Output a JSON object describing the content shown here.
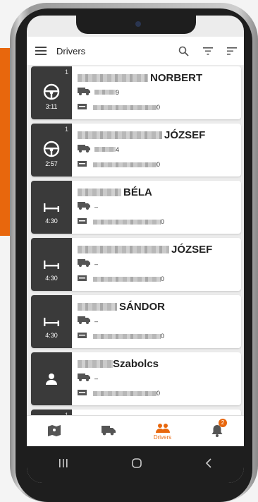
{
  "screen": {
    "title": "Drivers"
  },
  "drivers": [
    {
      "name": "NORBERT",
      "count": "1",
      "time": "3:11",
      "status": "driving",
      "truck": "9",
      "card": "0"
    },
    {
      "name": "JÓZSEF",
      "count": "1",
      "time": "2:57",
      "status": "driving",
      "truck": "4",
      "card": "0"
    },
    {
      "name": "BÉLA",
      "count": "",
      "time": "4:30",
      "status": "rest",
      "truck": "–",
      "card": "0"
    },
    {
      "name": "JÓZSEF",
      "count": "",
      "time": "4:30",
      "status": "rest",
      "truck": "–",
      "card": "0"
    },
    {
      "name": "SÁNDOR",
      "count": "",
      "time": "4:30",
      "status": "rest",
      "truck": "–",
      "card": "0"
    },
    {
      "name": "Szabolcs",
      "count": "",
      "time": "",
      "status": "person",
      "truck": "–",
      "card": "0"
    }
  ],
  "partial_card": {
    "count": "1"
  },
  "nav": {
    "drivers_label": "Drivers",
    "notification_count": "2"
  },
  "colors": {
    "accent": "#e8670d",
    "side": "#3a3a3a"
  }
}
